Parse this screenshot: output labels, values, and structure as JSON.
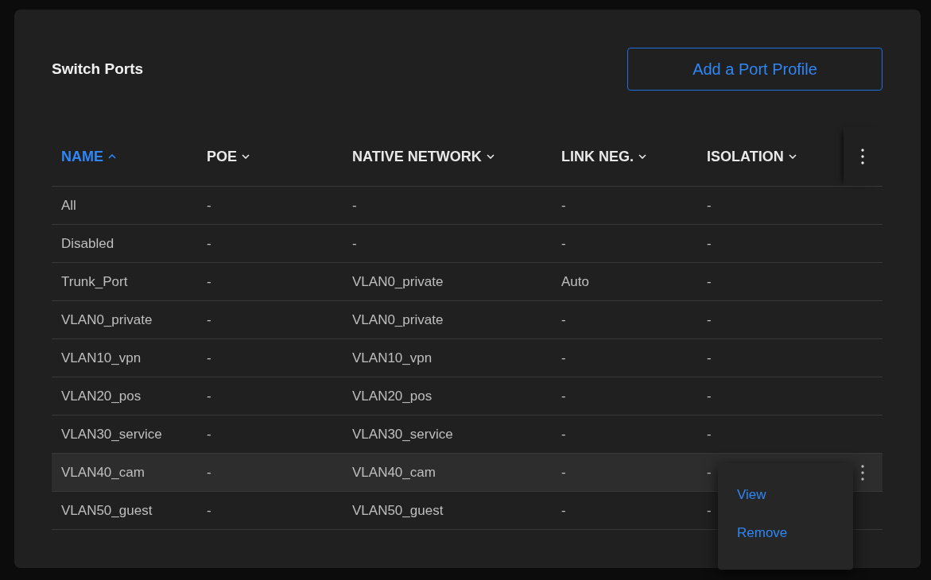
{
  "title": "Switch Ports",
  "add_button": "Add a Port Profile",
  "columns": [
    {
      "label": "NAME",
      "sorted": true
    },
    {
      "label": "POE",
      "sorted": false
    },
    {
      "label": "NATIVE NETWORK",
      "sorted": false
    },
    {
      "label": "LINK NEG.",
      "sorted": false
    },
    {
      "label": "ISOLATION",
      "sorted": false
    }
  ],
  "rows": [
    {
      "cells": [
        "All",
        "-",
        "-",
        "-",
        "-"
      ],
      "highlighted": false
    },
    {
      "cells": [
        "Disabled",
        "-",
        "-",
        "-",
        "-"
      ],
      "highlighted": false
    },
    {
      "cells": [
        "Trunk_Port",
        "-",
        "VLAN0_private",
        "Auto",
        "-"
      ],
      "highlighted": false
    },
    {
      "cells": [
        "VLAN0_private",
        "-",
        "VLAN0_private",
        "-",
        "-"
      ],
      "highlighted": false
    },
    {
      "cells": [
        "VLAN10_vpn",
        "-",
        "VLAN10_vpn",
        "-",
        "-"
      ],
      "highlighted": false
    },
    {
      "cells": [
        "VLAN20_pos",
        "-",
        "VLAN20_pos",
        "-",
        "-"
      ],
      "highlighted": false
    },
    {
      "cells": [
        "VLAN30_service",
        "-",
        "VLAN30_service",
        "-",
        "-"
      ],
      "highlighted": false
    },
    {
      "cells": [
        "VLAN40_cam",
        "-",
        "VLAN40_cam",
        "-",
        "-"
      ],
      "highlighted": true
    },
    {
      "cells": [
        "VLAN50_guest",
        "-",
        "VLAN50_guest",
        "-",
        "-"
      ],
      "highlighted": false
    }
  ],
  "row_menu": [
    "View",
    "Remove"
  ]
}
